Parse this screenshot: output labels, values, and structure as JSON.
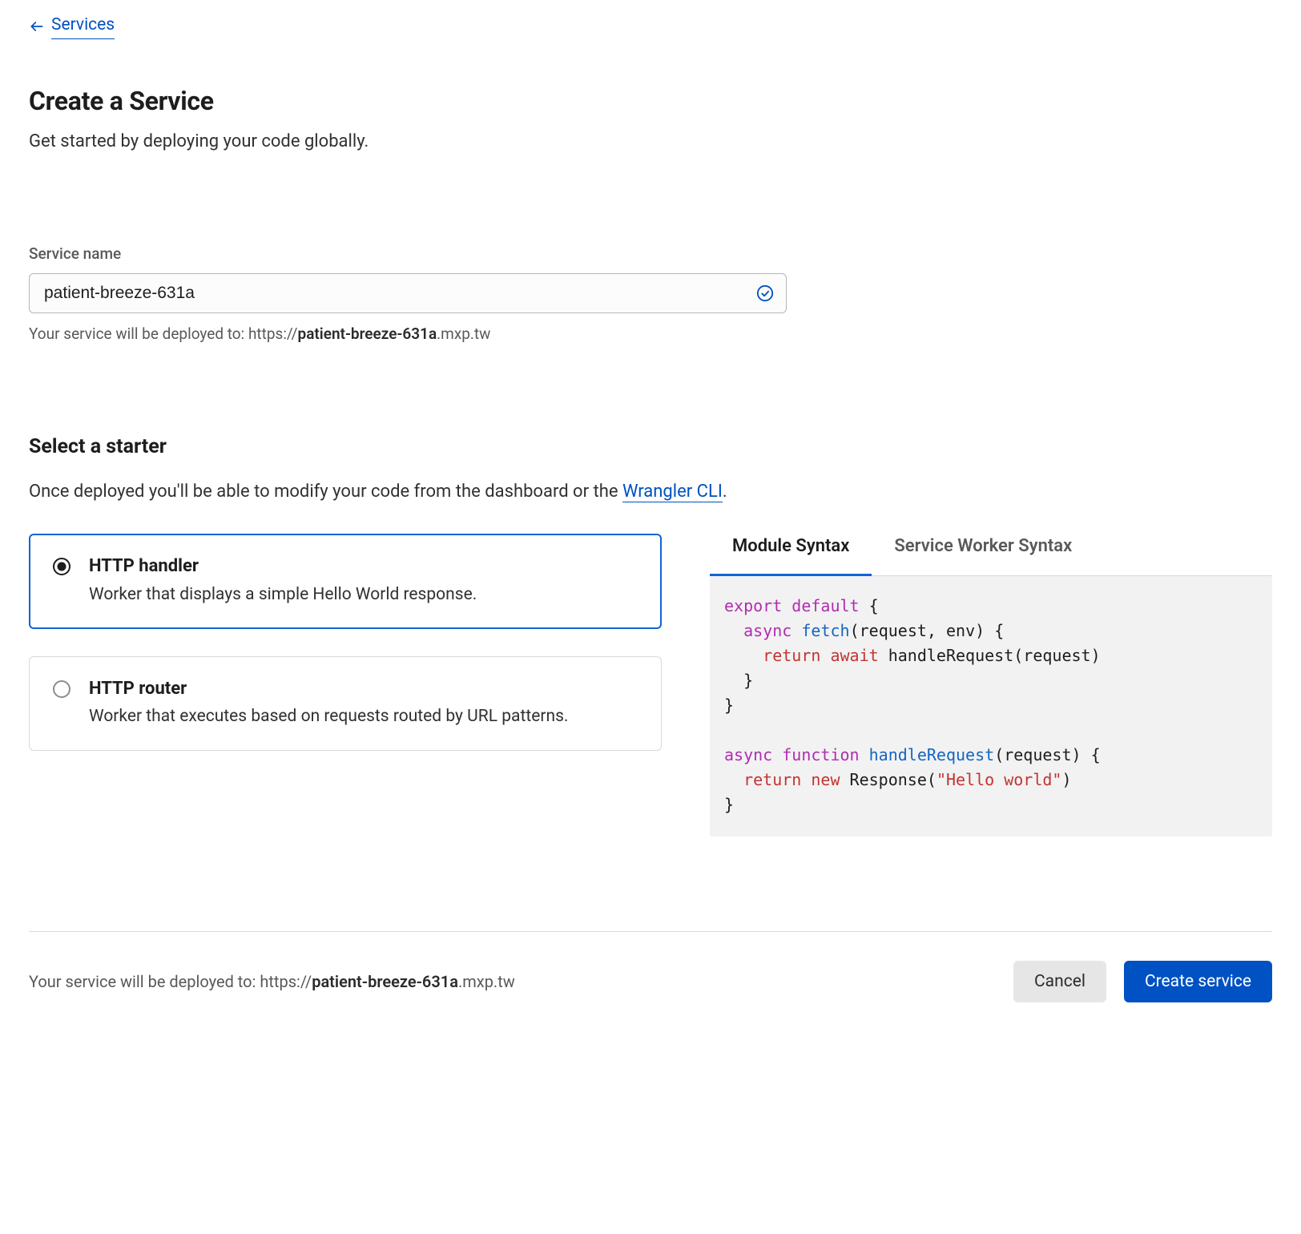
{
  "nav": {
    "back_label": "Services"
  },
  "header": {
    "title": "Create a Service",
    "subtitle": "Get started by deploying your code globally."
  },
  "service_name": {
    "label": "Service name",
    "value": "patient-breeze-631a",
    "deploy_prefix": "Your service will be deployed to: https://",
    "deploy_bold": "patient-breeze-631a",
    "deploy_suffix": ".mxp.tw"
  },
  "starter": {
    "title": "Select a starter",
    "desc_prefix": "Once deployed you'll be able to modify your code from the dashboard or the ",
    "desc_link": "Wrangler CLI",
    "desc_suffix": ".",
    "options": [
      {
        "title": "HTTP handler",
        "desc": "Worker that displays a simple Hello World response.",
        "selected": true
      },
      {
        "title": "HTTP router",
        "desc": "Worker that executes based on requests routed by URL patterns.",
        "selected": false
      }
    ],
    "tabs": [
      {
        "label": "Module Syntax",
        "active": true
      },
      {
        "label": "Service Worker Syntax",
        "active": false
      }
    ],
    "code": {
      "line1_kw1": "export",
      "line1_kw2": "default",
      "line1_rest": " {",
      "line2_kw": "async",
      "line2_fn": "fetch",
      "line2_rest": "(request, env) {",
      "line3_kw1": "return",
      "line3_kw2": "await",
      "line3_rest": " handleRequest(request)",
      "line4": "  }",
      "line5": "}",
      "blank": "",
      "line6_kw1": "async",
      "line6_kw2": "function",
      "line6_fn": "handleRequest",
      "line6_rest": "(request) {",
      "line7_kw1": "return",
      "line7_kw2": "new",
      "line7_pre": " Response(",
      "line7_str": "\"Hello world\"",
      "line7_post": ")",
      "line8": "}"
    }
  },
  "footer": {
    "cancel": "Cancel",
    "create": "Create service"
  }
}
